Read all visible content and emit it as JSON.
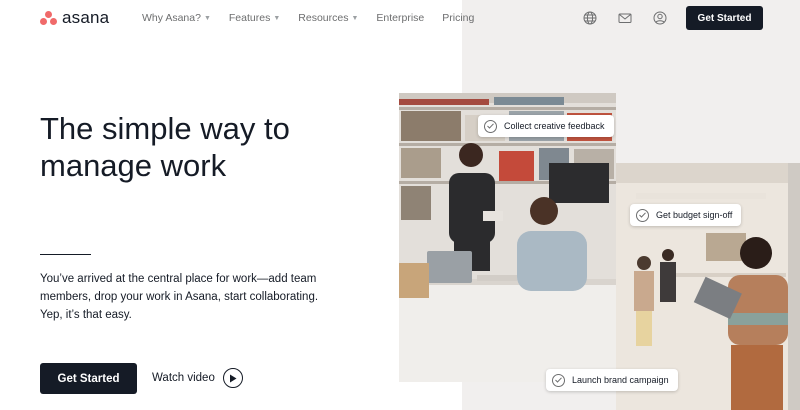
{
  "brand": {
    "name": "asana",
    "color": "#f06a6a"
  },
  "nav": {
    "links": [
      {
        "label": "Why Asana?",
        "dropdown": true
      },
      {
        "label": "Features",
        "dropdown": true
      },
      {
        "label": "Resources",
        "dropdown": true
      },
      {
        "label": "Enterprise",
        "dropdown": false
      },
      {
        "label": "Pricing",
        "dropdown": false
      }
    ],
    "icons": [
      "globe-icon",
      "mail-icon",
      "user-icon"
    ],
    "cta_label": "Get Started"
  },
  "hero": {
    "headline": "The simple way to manage work",
    "subtext": "You’ve arrived at the central place for work—add team members, drop your work in Asana, start collaborating. Yep, it’s that easy.",
    "primary_cta": "Get Started",
    "video_cta": "Watch video"
  },
  "tasks": [
    {
      "label": "Collect creative feedback"
    },
    {
      "label": "Get budget sign-off"
    },
    {
      "label": "Launch brand campaign"
    }
  ],
  "colors": {
    "dark": "#151b26",
    "panel": "#f1efee",
    "accent": "#f06a6a"
  }
}
